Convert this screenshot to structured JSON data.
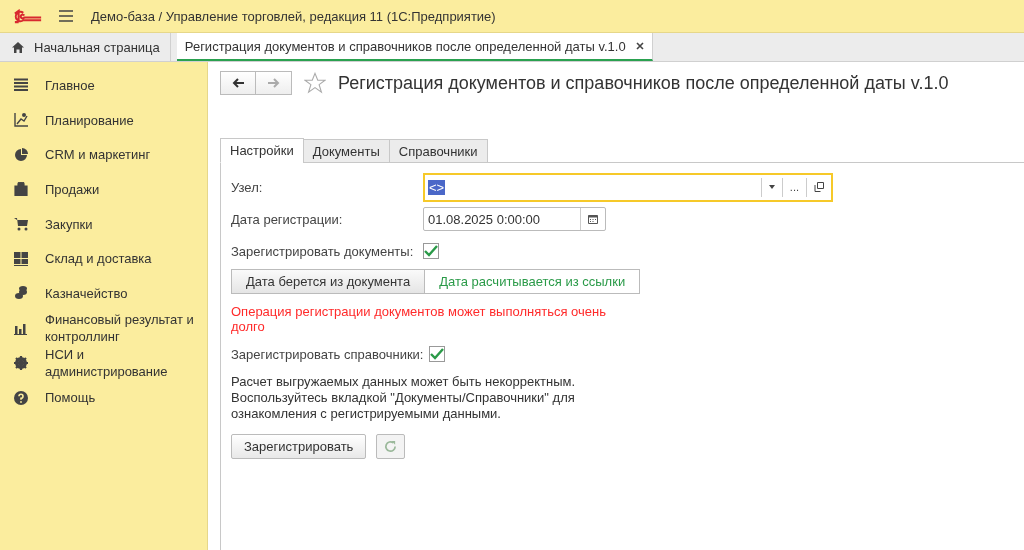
{
  "app_bar": {
    "title": "Демо-база / Управление торговлей, редакция 11  (1С:Предприятие)"
  },
  "open_tabs": [
    {
      "label": "Начальная страница",
      "selected": false,
      "kind": "home"
    },
    {
      "label": "Регистрация документов и справочников после определенной даты v.1.0",
      "selected": true,
      "kind": "doc"
    }
  ],
  "sidebar": {
    "items": [
      {
        "label": "Главное"
      },
      {
        "label": "Планирование"
      },
      {
        "label": "CRM и маркетинг"
      },
      {
        "label": "Продажи"
      },
      {
        "label": "Закупки"
      },
      {
        "label": "Склад и доставка"
      },
      {
        "label": "Казначейство"
      },
      {
        "label": "Финансовый результат и контроллинг"
      },
      {
        "label": "НСИ и администрирование"
      },
      {
        "label": "Помощь"
      }
    ]
  },
  "form": {
    "title": "Регистрация документов и справочников после определенной даты v.1.0",
    "tabs": [
      {
        "label": "Настройки",
        "selected": true
      },
      {
        "label": "Документы",
        "selected": false
      },
      {
        "label": "Справочники",
        "selected": false
      }
    ],
    "node": {
      "label": "Узел:",
      "value": "<>",
      "more": "..."
    },
    "date": {
      "label": "Дата регистрации:",
      "value": "01.08.2025  0:00:00"
    },
    "register_documents": {
      "label": "Зарегистрировать документы:",
      "checked": true
    },
    "date_source": [
      {
        "label": "Дата берется из документа",
        "selected": false
      },
      {
        "label": "Дата расчитывается из ссылки",
        "selected": true
      }
    ],
    "warning": "Операция регистрации документов может выполняться очень долго",
    "register_catalogs": {
      "label": "Зарегистрировать справочники:",
      "checked": true
    },
    "note": "Расчет выгружаемых данных может быть некорректным. Воспользуйтесь вкладкой \"Документы/Справочники\" для ознакомления с регистрируемыми данными.",
    "register_button": "Зарегистрировать"
  }
}
